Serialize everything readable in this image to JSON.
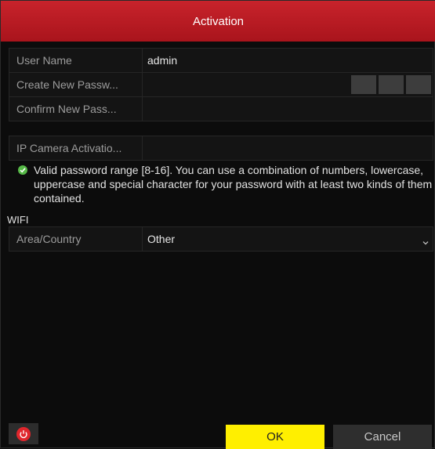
{
  "dialog": {
    "title": "Activation"
  },
  "fields": [
    {
      "label": "User Name",
      "value": "admin"
    },
    {
      "label": "Create New Passw...",
      "value": ""
    },
    {
      "label": "Confirm New Pass...",
      "value": ""
    },
    {
      "label": "IP Camera Activatio...",
      "value": ""
    }
  ],
  "password_note": "Valid password range [8-16]. You can use a combination of numbers, lowercase, uppercase and special character for your password with at least two kinds of them contained.",
  "wifi": {
    "section_label": "WIFI",
    "area_label": "Area/Country",
    "area_value": "Other"
  },
  "footer": {
    "ok_label": "OK",
    "cancel_label": "Cancel"
  },
  "colors": {
    "title_bar": "#c0202a",
    "ok_button": "#ffef00",
    "valid_check": "#56b947"
  }
}
